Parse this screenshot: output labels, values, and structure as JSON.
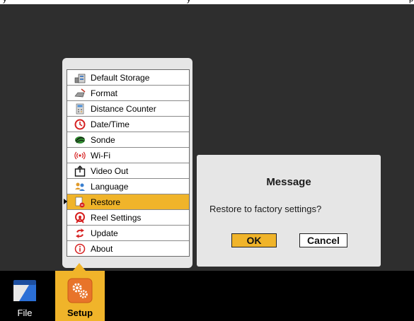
{
  "top_strip": {
    "fragments": [
      "y",
      "y",
      "p"
    ]
  },
  "menu": {
    "items": [
      {
        "label": "Default Storage",
        "icon": "storage-icon",
        "selected": false
      },
      {
        "label": "Format",
        "icon": "format-icon",
        "selected": false
      },
      {
        "label": "Distance Counter",
        "icon": "distance-counter-icon",
        "selected": false
      },
      {
        "label": "Date/Time",
        "icon": "clock-icon",
        "selected": false
      },
      {
        "label": "Sonde",
        "icon": "sonde-icon",
        "selected": false
      },
      {
        "label": "Wi-Fi",
        "icon": "wifi-icon",
        "selected": false
      },
      {
        "label": "Video Out",
        "icon": "video-out-icon",
        "selected": false
      },
      {
        "label": "Language",
        "icon": "language-icon",
        "selected": false
      },
      {
        "label": "Restore",
        "icon": "restore-icon",
        "selected": true
      },
      {
        "label": "Reel Settings",
        "icon": "reel-icon",
        "selected": false
      },
      {
        "label": "Update",
        "icon": "update-icon",
        "selected": false
      },
      {
        "label": "About",
        "icon": "info-icon",
        "selected": false
      }
    ]
  },
  "dialog": {
    "title": "Message",
    "text": "Restore to factory settings?",
    "ok_label": "OK",
    "cancel_label": "Cancel"
  },
  "taskbar": {
    "file_label": "File",
    "setup_label": "Setup"
  },
  "colors": {
    "accent": "#f0b42a",
    "background": "#2e2e2e",
    "panel": "#e6e6e6"
  }
}
